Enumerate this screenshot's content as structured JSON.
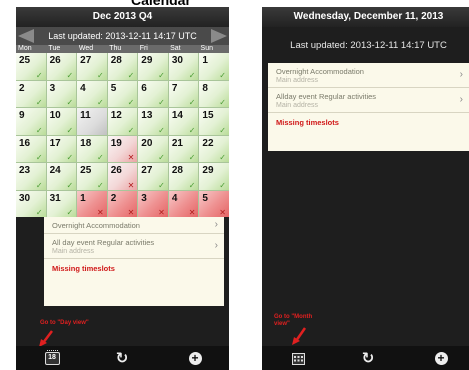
{
  "caption": "Calendar",
  "left": {
    "title": "Dec 2013 Q4",
    "last_updated": "Last updated: 2013-12-11 14:17 UTC",
    "weekdays": [
      "Mon",
      "Tue",
      "Wed",
      "Thu",
      "Fri",
      "Sat",
      "Sun"
    ],
    "weeks": [
      [
        {
          "d": "25",
          "s": "ok"
        },
        {
          "d": "26",
          "s": "ok"
        },
        {
          "d": "27",
          "s": "ok"
        },
        {
          "d": "28",
          "s": "ok"
        },
        {
          "d": "29",
          "s": "ok"
        },
        {
          "d": "30",
          "s": "ok"
        },
        {
          "d": "1",
          "s": "ok"
        }
      ],
      [
        {
          "d": "2",
          "s": "ok"
        },
        {
          "d": "3",
          "s": "ok"
        },
        {
          "d": "4",
          "s": "ok"
        },
        {
          "d": "5",
          "s": "ok"
        },
        {
          "d": "6",
          "s": "ok"
        },
        {
          "d": "7",
          "s": "ok"
        },
        {
          "d": "8",
          "s": "ok"
        }
      ],
      [
        {
          "d": "9",
          "s": "ok"
        },
        {
          "d": "10",
          "s": "ok"
        },
        {
          "d": "11",
          "s": "grey"
        },
        {
          "d": "12",
          "s": "ok"
        },
        {
          "d": "13",
          "s": "ok"
        },
        {
          "d": "14",
          "s": "ok"
        },
        {
          "d": "15",
          "s": "ok"
        }
      ],
      [
        {
          "d": "16",
          "s": "ok"
        },
        {
          "d": "17",
          "s": "ok"
        },
        {
          "d": "18",
          "s": "ok"
        },
        {
          "d": "19",
          "s": "redfade"
        },
        {
          "d": "20",
          "s": "ok"
        },
        {
          "d": "21",
          "s": "ok"
        },
        {
          "d": "22",
          "s": "ok"
        }
      ],
      [
        {
          "d": "23",
          "s": "ok"
        },
        {
          "d": "24",
          "s": "ok"
        },
        {
          "d": "25",
          "s": "ok"
        },
        {
          "d": "26",
          "s": "redfade"
        },
        {
          "d": "27",
          "s": "ok"
        },
        {
          "d": "28",
          "s": "ok"
        },
        {
          "d": "29",
          "s": "ok"
        }
      ],
      [
        {
          "d": "30",
          "s": "ok"
        },
        {
          "d": "31",
          "s": "ok"
        },
        {
          "d": "1",
          "s": "red"
        },
        {
          "d": "2",
          "s": "red"
        },
        {
          "d": "3",
          "s": "red"
        },
        {
          "d": "4",
          "s": "red"
        },
        {
          "d": "5",
          "s": "red"
        }
      ]
    ],
    "ok_mark": "✓",
    "bad_mark": "✕",
    "events": [
      {
        "title": "Overnight Accommodation",
        "sub": ""
      },
      {
        "title": "All day event Regular activities",
        "sub": "Main address"
      }
    ],
    "missing": "Missing timeslots",
    "annotation": "Go to \"Day view\"",
    "bottom": {
      "calendar_day": "18",
      "refresh": "↻",
      "add": "+"
    }
  },
  "right": {
    "title": "Wednesday, December 11, 2013",
    "last_updated": "Last updated: 2013-12-11 14:17 UTC",
    "events": [
      {
        "title": "Overnight Accommodation",
        "sub": "Main address"
      },
      {
        "title": "Allday event Regular activities",
        "sub": "Main address"
      }
    ],
    "missing": "Missing timeslots",
    "annotation": "Go to \"Month view\"",
    "bottom": {
      "refresh": "↻",
      "add": "+"
    }
  },
  "colors": {
    "ok": "#4a9c33",
    "bad": "#b01d1d",
    "missing": "#d01818",
    "annotation": "#e02020"
  }
}
